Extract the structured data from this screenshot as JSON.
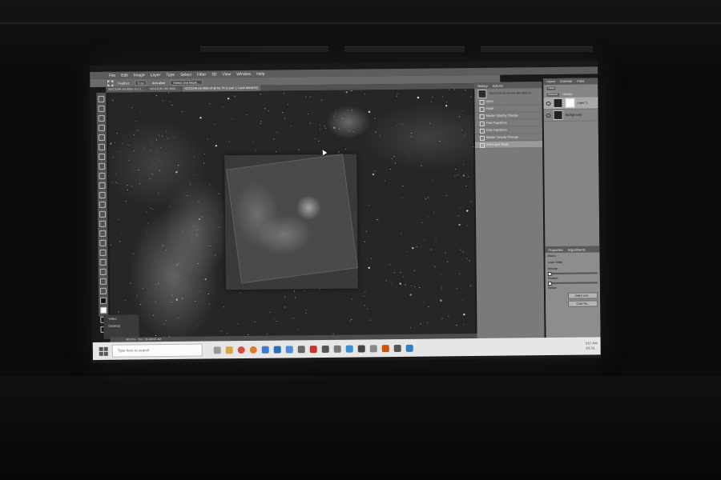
{
  "app": {
    "logo": "Ps",
    "menu": [
      "File",
      "Edit",
      "Image",
      "Layer",
      "Type",
      "Select",
      "Filter",
      "3D",
      "View",
      "Window",
      "Help"
    ]
  },
  "options_bar": {
    "feather_label": "Feather:",
    "feather_value": "0 px",
    "antialias_label": "Anti-alias",
    "select_mask_button": "Select and Mask..."
  },
  "document_tabs": [
    "NGC3246-Ha-900s-1x1-1...",
    "NGC3246-OIII-900s...",
    "NGC3246-Ha-900s-M @ 66.7% (Layer 1, Layer Mask/16)"
  ],
  "status_bar": {
    "zoom": "66.67%",
    "doc": "Doc: 28.4M/55.4M"
  },
  "desktop_tiles": [
    "Video",
    "Desktop"
  ],
  "history_panel": {
    "tabs": [
      "History",
      "Actions"
    ],
    "snapshot": "NGC3246-Bicolor-Ha-OIII-900s.tif",
    "items": [
      "Open",
      "Paste",
      "Master Opacity Change",
      "Free Transform",
      "Free Transform",
      "Master Opacity Change",
      "Add Layer Mask"
    ],
    "selected_index": 6
  },
  "layers_panel": {
    "tabs": [
      "Layers",
      "Channels",
      "Paths"
    ],
    "filter": "Kind",
    "blend": "Normal",
    "opacity_label": "Opacity:",
    "layers": [
      {
        "name": "Layer 1",
        "selected": true,
        "has_mask": true
      },
      {
        "name": "Background",
        "selected": false,
        "has_mask": false
      }
    ]
  },
  "properties_panel": {
    "tabs": [
      "Properties",
      "Adjustments"
    ],
    "type_label": "Masks",
    "mask_label": "Layer Mask",
    "density_label": "Density:",
    "feather_label": "Feather:",
    "refine_label": "Refine:",
    "select_mask_button": "Select and ...",
    "color_range_button": "Color Ra..."
  },
  "taskbar": {
    "search_placeholder": "Type here to search",
    "time": "3:57 PM",
    "date": "3/17/2..."
  }
}
